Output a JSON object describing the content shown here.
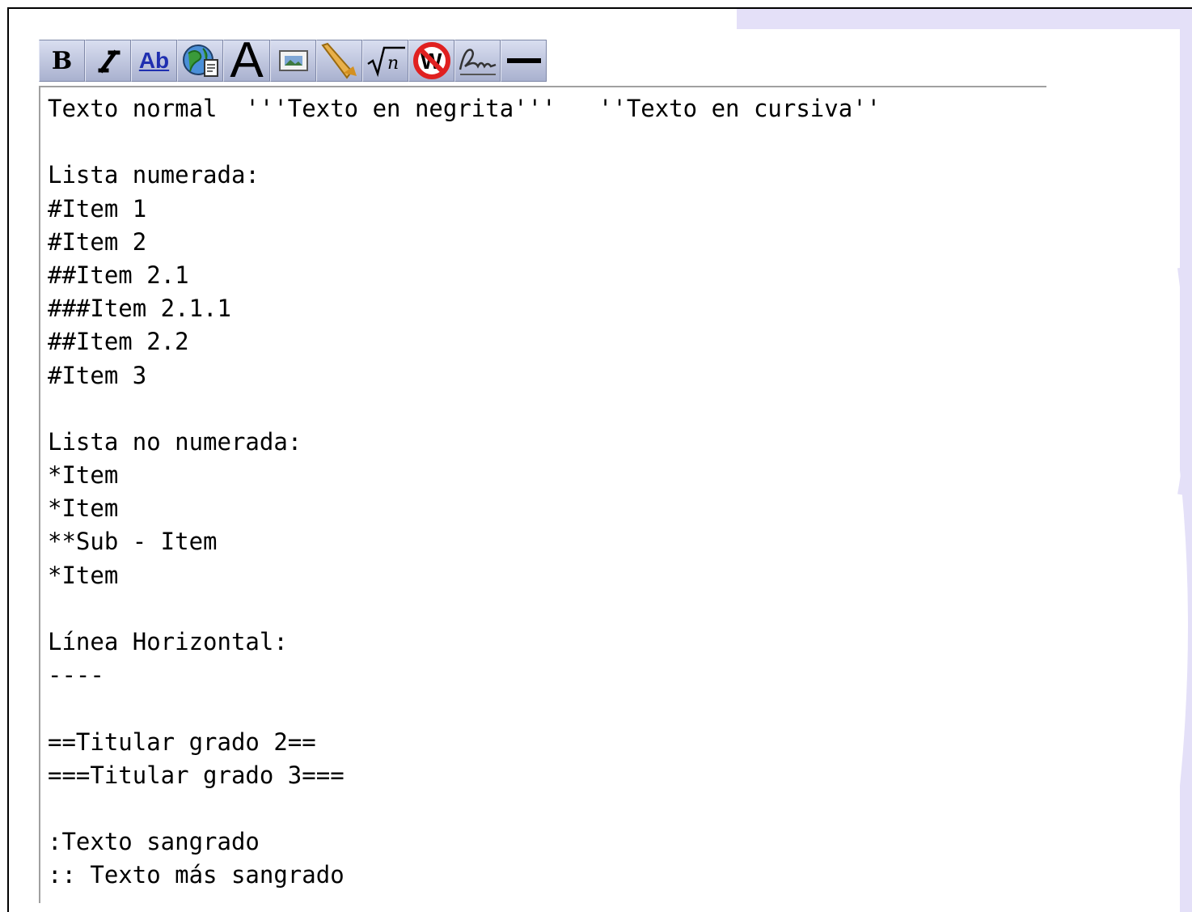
{
  "toolbar": {
    "bold_label": "B",
    "link_label": "Ab",
    "headline_label": "A",
    "buttons": [
      {
        "name": "bold",
        "icon": "bold-icon"
      },
      {
        "name": "italic",
        "icon": "italic-icon"
      },
      {
        "name": "internal-link",
        "icon": "internal-link-icon"
      },
      {
        "name": "external-link",
        "icon": "globe-link-icon"
      },
      {
        "name": "headline",
        "icon": "headline-icon"
      },
      {
        "name": "image",
        "icon": "image-icon"
      },
      {
        "name": "media",
        "icon": "media-icon"
      },
      {
        "name": "math",
        "icon": "math-formula-icon"
      },
      {
        "name": "nowiki",
        "icon": "nowiki-icon"
      },
      {
        "name": "signature",
        "icon": "signature-icon"
      },
      {
        "name": "horizontal-line",
        "icon": "horizontal-line-icon"
      }
    ]
  },
  "editor": {
    "lines": [
      "Texto normal  '''Texto en negrita'''   ''Texto en cursiva''",
      "",
      "Lista numerada:",
      "#Item 1",
      "#Item 2",
      "##Item 2.1",
      "###Item 2.1.1",
      "##Item 2.2",
      "#Item 3",
      "",
      "Lista no numerada:",
      "*Item",
      "*Item",
      "**Sub - Item",
      "*Item",
      "",
      "Línea Horizontal:",
      "----",
      "",
      "==Titular grado 2==",
      "===Titular grado 3===",
      "",
      ":Texto sangrado",
      ":: Texto más sangrado"
    ]
  },
  "colors": {
    "background_accent": "#e4e0f8",
    "toolbar_button": "#b9c0dc",
    "nowiki_red": "#e02020",
    "link_blue": "#1f2fb0"
  }
}
